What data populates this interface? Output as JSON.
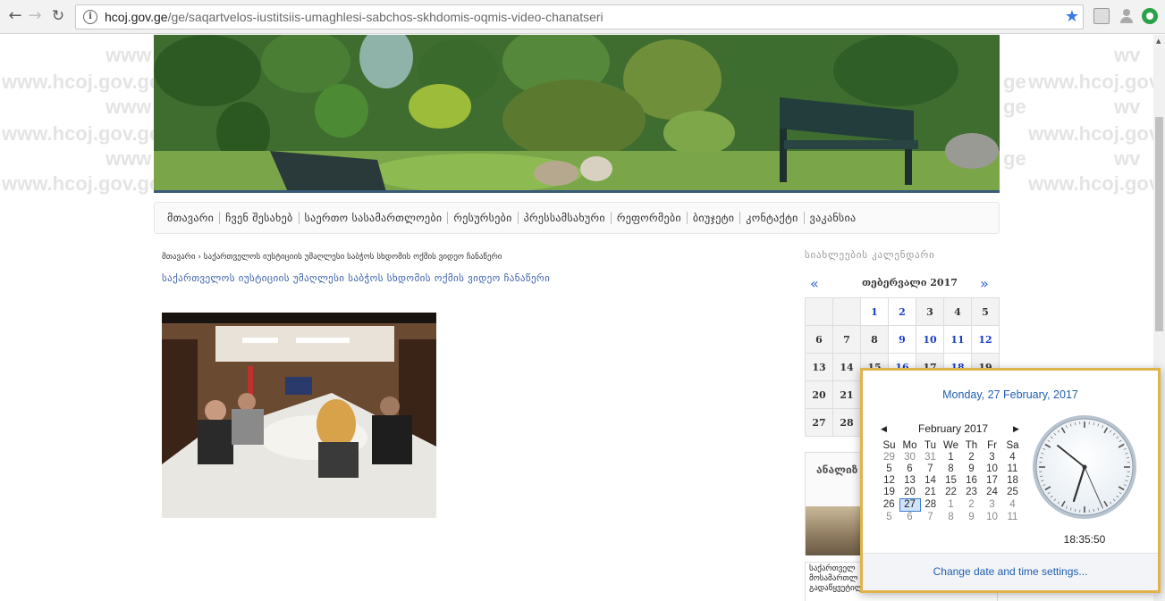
{
  "browser": {
    "url_host": "hcoj.gov.ge",
    "url_path": "/ge/saqartvelos-iustitsiis-umaghlesi-sabchos-skhdomis-oqmis-video-chanatseri"
  },
  "watermark_text": "www.hcoj.gov.ge",
  "watermark_fragment_a": "www",
  "watermark_fragment_b": "ge",
  "watermark_fragment_c": "wv",
  "menu": [
    "მთავარი",
    "ჩვენ შესახებ",
    "საერთო სასამართლოები",
    "რესურსები",
    "პრესსამსახური",
    "რეფორმები",
    "ბიუჯეტი",
    "კონტაქტი",
    "ვაკანსია"
  ],
  "breadcrumb": "მთავარი  ›  საქართველოს იუსტიციის უმაღლესი საბჭოს სხდომის ოქმის ვიდეო ჩანაწერი",
  "article_title": "საქართველოს იუსტიციის უმაღლესი საბჭოს სხდომის ოქმის ვიდეო ჩანაწერი",
  "sidebar": {
    "calendar_title": "სიახლეების კალენდარი",
    "month_label": "თებერვალი 2017",
    "prev": "«",
    "next": "»",
    "rows": [
      [
        "",
        "",
        "1",
        "2",
        "3",
        "4",
        "5"
      ],
      [
        "6",
        "7",
        "8",
        "9",
        "10",
        "11",
        "12"
      ],
      [
        "13",
        "14",
        "15",
        "16",
        "17",
        "18",
        "19"
      ],
      [
        "20",
        "21",
        "",
        "",
        "",
        "",
        ""
      ],
      [
        "27",
        "28",
        "",
        "",
        "",
        "",
        ""
      ]
    ],
    "box_title": "ანალიზ",
    "news_lines": [
      "საქართველ",
      "მოსამართლ",
      "გადაწყვეტილებები"
    ]
  },
  "popup": {
    "full_date": "Monday, 27 February, 2017",
    "month": "February 2017",
    "weekdays": [
      "Su",
      "Mo",
      "Tu",
      "We",
      "Th",
      "Fr",
      "Sa"
    ],
    "weeks": [
      [
        "29",
        "30",
        "31",
        "1",
        "2",
        "3",
        "4"
      ],
      [
        "5",
        "6",
        "7",
        "8",
        "9",
        "10",
        "11"
      ],
      [
        "12",
        "13",
        "14",
        "15",
        "16",
        "17",
        "18"
      ],
      [
        "19",
        "20",
        "21",
        "22",
        "23",
        "24",
        "25"
      ],
      [
        "26",
        "27",
        "28",
        "1",
        "2",
        "3",
        "4"
      ],
      [
        "5",
        "6",
        "7",
        "8",
        "9",
        "10",
        "11"
      ]
    ],
    "selected_day": "27",
    "time": "18:35:50",
    "settings_link": "Change date and time settings..."
  },
  "colors": {
    "link_blue": "#1f5fb0",
    "popup_border": "#e0b44b",
    "title_blue": "#3a5faa"
  }
}
